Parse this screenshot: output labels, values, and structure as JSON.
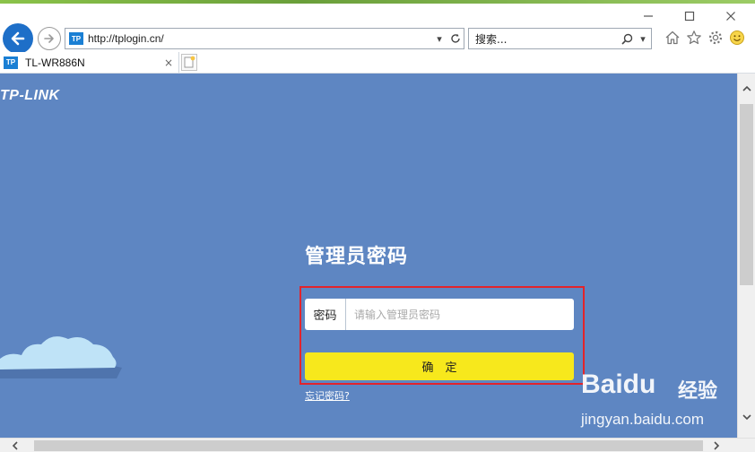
{
  "browser": {
    "address": {
      "url": "http://tplogin.cn/",
      "favicon_text": "TP"
    },
    "search": {
      "placeholder": "搜索..."
    },
    "tab": {
      "title": "TL-WR886N",
      "favicon_text": "TP",
      "close_label": "×"
    },
    "window_controls": [
      "minimize",
      "maximize",
      "close"
    ]
  },
  "page": {
    "brand": "TP-LINK",
    "title": "管理员密码",
    "password": {
      "label": "密码",
      "placeholder": "请输入管理员密码",
      "value": ""
    },
    "confirm_label": "确　定",
    "forgot_label": "忘记密码?"
  },
  "watermark": {
    "logo": "Baidu",
    "brand_cn": "经验",
    "url": "jingyan.baidu.com"
  },
  "colors": {
    "page_background": "#5e86c2",
    "button_yellow": "#f7e81c",
    "highlight_red": "#e3242b",
    "browser_blue": "#1e6fc8"
  }
}
